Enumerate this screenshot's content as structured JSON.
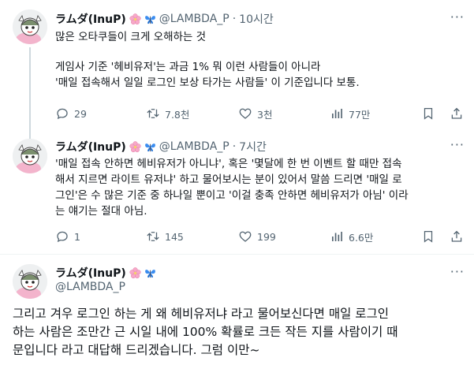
{
  "author": {
    "display_name": "ラムダ(InuP)",
    "handle": "@LAMBDA_P"
  },
  "tweets": [
    {
      "time": "10시간",
      "lines_a": [
        "많은 오타쿠들이 크게 오해하는 것"
      ],
      "lines_b": [
        "게임사 기준 '헤비유저'는 과금 1% 뭐 이런 사람들이 아니라",
        "'매일 접속해서 일일 로그인 보상 타가는 사람들' 이 기준입니다 보통."
      ],
      "replies": "29",
      "retweets": "7.8천",
      "likes": "3천",
      "views": "77만"
    },
    {
      "time": "7시간",
      "lines": [
        "'매일 접속 안하면 헤비유저가 아니냐', 혹은 '몇달에 한 번 이벤트 할 때만 접속",
        "해서 지르면 라이트 유저냐' 하고 물어보시는 분이 있어서 말씀 드리면 '매일 로",
        "그인'은 수 많은 기준 중 하나일 뿐이고 '이걸 충족 안하면 헤비유저가 아님' 이라",
        "는 얘기는 절대 아님."
      ],
      "replies": "1",
      "retweets": "145",
      "likes": "199",
      "views": "6.6만"
    },
    {
      "lines": [
        "그리고 겨우 로그인 하는 게 왜 헤비유저냐 라고 물어보신다면 매일 로그인",
        "하는 사람은 조만간 근 시일 내에 100% 확률로 크든 작든 지를 사람이기 때",
        "문입니다 라고 대답해 드리겠습니다. 그럼 이만~"
      ]
    }
  ],
  "icons": {
    "more": "more-horizontal-icon",
    "reply": "reply-icon",
    "retweet": "retweet-icon",
    "like": "heart-icon",
    "views": "views-icon",
    "bookmark": "bookmark-icon",
    "share": "share-icon",
    "emoji_1": "cherry-blossom-icon",
    "emoji_2": "butterfly-icon"
  },
  "colors": {
    "text": "#0f1419",
    "muted": "#536471",
    "thread_line": "#cfd9de",
    "divider": "#eff3f4"
  }
}
